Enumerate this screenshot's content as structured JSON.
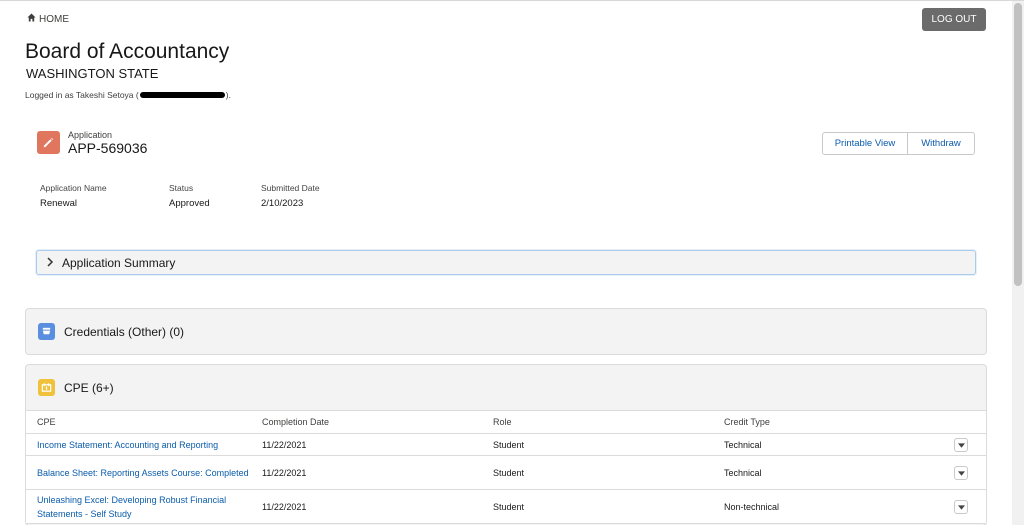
{
  "nav": {
    "home_label": "HOME",
    "logout_label": "LOG OUT"
  },
  "header": {
    "title": "Board of Accountancy",
    "subtitle": "WASHINGTON STATE",
    "logged_in_prefix": "Logged in as Takeshi Setoya (",
    "logged_in_suffix": ")."
  },
  "application": {
    "label": "Application",
    "id": "APP-569036",
    "actions": {
      "printable": "Printable View",
      "withdraw": "Withdraw"
    },
    "fields": {
      "name_label": "Application Name",
      "name_value": "Renewal",
      "status_label": "Status",
      "status_value": "Approved",
      "submitted_label": "Submitted Date",
      "submitted_value": "2/10/2023"
    }
  },
  "summary": {
    "label": "Application Summary"
  },
  "credentials": {
    "title": "Credentials (Other) (0)"
  },
  "cpe": {
    "title": "CPE (6+)",
    "columns": [
      "CPE",
      "Completion Date",
      "Role",
      "Credit Type"
    ],
    "rows": [
      {
        "name": "Income Statement: Accounting and Reporting",
        "date": "11/22/2021",
        "role": "Student",
        "credit": "Technical"
      },
      {
        "name": "Balance Sheet: Reporting Assets Course: Completed",
        "date": "11/22/2021",
        "role": "Student",
        "credit": "Technical"
      },
      {
        "name": "Unleashing Excel: Developing Robust Financial Statements - Self Study",
        "date": "11/22/2021",
        "role": "Student",
        "credit": "Non-technical"
      }
    ]
  },
  "colors": {
    "accent": "#0b5cab",
    "app_icon": "#e1765f",
    "credentials_icon": "#5a8fe0",
    "cpe_icon": "#f0c23b",
    "logout_bg": "#6b6b6b"
  },
  "icons": {
    "home": "home-icon",
    "application": "pencil-icon",
    "credentials": "badge-icon",
    "cpe": "lightbox-icon",
    "row_menu": "chevron-down-icon",
    "summary_toggle": "chevron-right-icon"
  }
}
